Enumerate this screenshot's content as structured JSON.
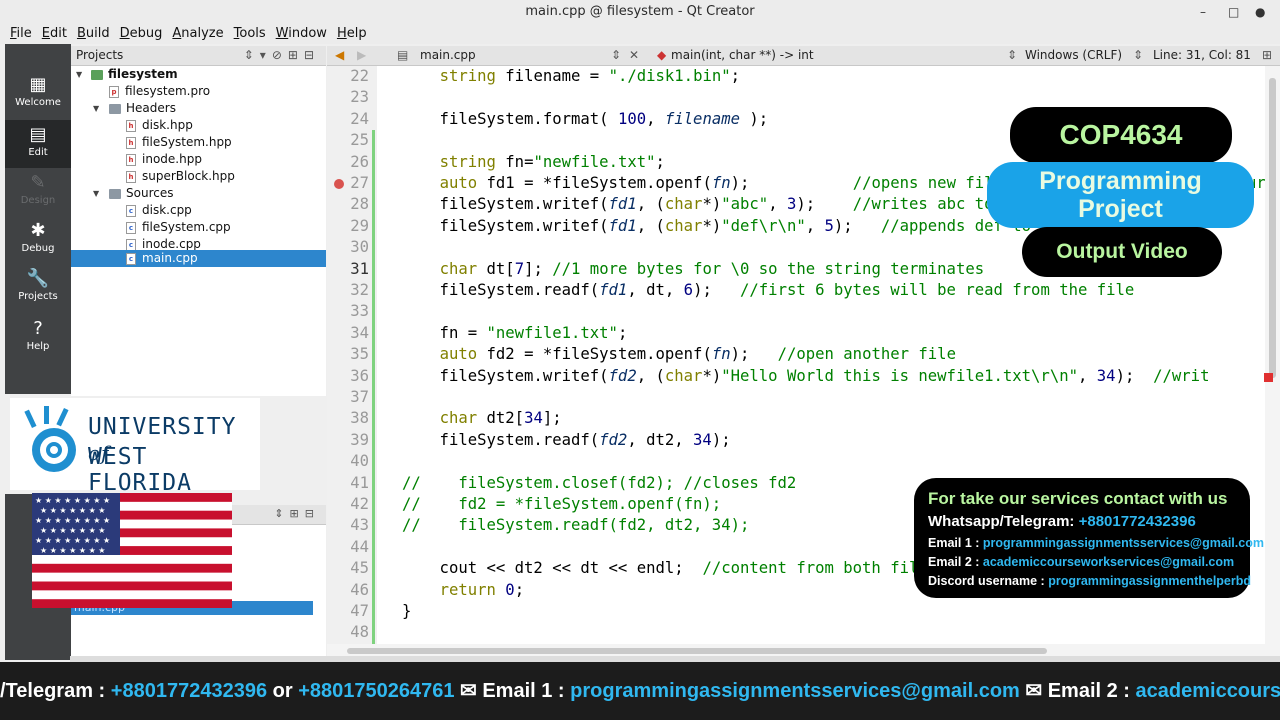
{
  "window": {
    "title": "main.cpp @ filesystem - Qt Creator",
    "minimize": "–",
    "maximize": "□",
    "close": "●"
  },
  "menu": [
    "File",
    "Edit",
    "Build",
    "Debug",
    "Analyze",
    "Tools",
    "Window",
    "Help"
  ],
  "modes": [
    {
      "label": "Welcome",
      "glyph": "▦",
      "icon": "grid-icon"
    },
    {
      "label": "Edit",
      "glyph": "▤",
      "icon": "document-icon"
    },
    {
      "label": "Design",
      "glyph": "✎",
      "icon": "pencil-icon"
    },
    {
      "label": "Debug",
      "glyph": "✱",
      "icon": "bug-icon"
    },
    {
      "label": "Projects",
      "glyph": "🔧",
      "icon": "wrench-icon"
    },
    {
      "label": "Help",
      "glyph": "?",
      "icon": "help-icon"
    }
  ],
  "projects_panel": {
    "title": "Projects",
    "project": "filesystem",
    "pro_file": "filesystem.pro",
    "headers_label": "Headers",
    "headers": [
      "disk.hpp",
      "fileSystem.hpp",
      "inode.hpp",
      "superBlock.hpp"
    ],
    "sources_label": "Sources",
    "sources": [
      "disk.cpp",
      "fileSystem.cpp",
      "inode.cpp",
      "main.cpp"
    ]
  },
  "lower_panel": {
    "selected_file": "main.cpp"
  },
  "editor_header": {
    "file": "main.cpp",
    "function": "main(int, char **) -> int",
    "line_ending": "Windows (CRLF)",
    "position": "Line: 31, Col: 81"
  },
  "code": [
    {
      "n": "22",
      "html": "    <span class=\"k\">string</span> filename = <span class=\"s\">\"./disk1.bin\"</span>;"
    },
    {
      "n": "23",
      "html": ""
    },
    {
      "n": "24",
      "html": "    fileSystem.format( <span class=\"n\">100</span>, <span class=\"p\">filename</span> );"
    },
    {
      "n": "25",
      "html": ""
    },
    {
      "n": "26",
      "html": "    <span class=\"k\">string</span> fn=<span class=\"s\">\"newfile.txt\"</span>;"
    },
    {
      "n": "27",
      "html": "    <span class=\"k\">auto</span> fd1 = *fileSystem.openf(<span class=\"p\">fn</span>);           <span class=\"c\">//opens new file named newfile.txt and returns an in</span>",
      "bp": true
    },
    {
      "n": "28",
      "html": "    fileSystem.writef(<span class=\"p\">fd1</span>, (<span class=\"k\">char</span>*)<span class=\"s\">\"abc\"</span>, <span class=\"n\">3</span>);    <span class=\"c\">//writes abc to newfile.txt</span>"
    },
    {
      "n": "29",
      "html": "    fileSystem.writef(<span class=\"p\">fd1</span>, (<span class=\"k\">char</span>*)<span class=\"s\">\"def\\r\\n\"</span>, <span class=\"n\">5</span>);   <span class=\"c\">//appends def to the file</span>"
    },
    {
      "n": "30",
      "html": ""
    },
    {
      "n": "31",
      "html": "    <span class=\"k\">char</span> dt[<span class=\"n\">7</span>]; <span class=\"c\">//1 more bytes for \\0 so the string terminates</span>",
      "cur": true
    },
    {
      "n": "32",
      "html": "    fileSystem.readf(<span class=\"p\">fd1</span>, dt, <span class=\"n\">6</span>);   <span class=\"c\">//first 6 bytes will be read from the file</span>"
    },
    {
      "n": "33",
      "html": ""
    },
    {
      "n": "34",
      "html": "    fn = <span class=\"s\">\"newfile1.txt\"</span>;"
    },
    {
      "n": "35",
      "html": "    <span class=\"k\">auto</span> fd2 = *fileSystem.openf(<span class=\"p\">fn</span>);   <span class=\"c\">//open another file</span>"
    },
    {
      "n": "36",
      "html": "    fileSystem.writef(<span class=\"p\">fd2</span>, (<span class=\"k\">char</span>*)<span class=\"s\">\"Hello World this is newfile1.txt\\r\\n\"</span>, <span class=\"n\">34</span>);  <span class=\"c\">//writ</span>"
    },
    {
      "n": "37",
      "html": ""
    },
    {
      "n": "38",
      "html": "    <span class=\"k\">char</span> dt2[<span class=\"n\">34</span>];"
    },
    {
      "n": "39",
      "html": "    fileSystem.readf(<span class=\"p\">fd2</span>, dt2, <span class=\"n\">34</span>);"
    },
    {
      "n": "40",
      "html": ""
    },
    {
      "n": "41",
      "html": "<span class=\"c\">//    fileSystem.closef(fd2); //closes fd2</span>"
    },
    {
      "n": "42",
      "html": "<span class=\"c\">//    fd2 = *fileSystem.openf(fn);</span>"
    },
    {
      "n": "43",
      "html": "<span class=\"c\">//    fileSystem.readf(fd2, dt2, 34);</span>"
    },
    {
      "n": "44",
      "html": ""
    },
    {
      "n": "45",
      "html": "    cout &lt;&lt; dt2 &lt;&lt; dt &lt;&lt; endl;  <span class=\"c\">//content from both files</span>"
    },
    {
      "n": "46",
      "html": "    <span class=\"k\">return</span> <span class=\"n\">0</span>;"
    },
    {
      "n": "47",
      "html": "}"
    },
    {
      "n": "48",
      "html": ""
    }
  ],
  "overlay": {
    "course": "COP4634",
    "project_line1": "Programming",
    "project_line2": "Project",
    "output": "Output Video",
    "university_line1": "UNIVERSITY",
    "university_of": "of",
    "university_line2": "WEST FLORIDA"
  },
  "contact": {
    "heading": "For take our services contact with us",
    "whatsapp_label": "Whatsapp/Telegram:",
    "whatsapp_value": "+8801772432396",
    "email1_label": "Email 1 :",
    "email1_value": "programmingassignmentsservices@gmail.com",
    "email2_label": "Email 2 :",
    "email2_value": "academiccourseworkservices@gmail.com",
    "discord_label": "Discord username :",
    "discord_value": "programmingassignmenthelperbd"
  },
  "ticker": {
    "t1": "/Telegram : ",
    "v1": "+8801772432396",
    "t2": " or ",
    "v2": "+8801750264761",
    "t3": " ✉ Email 1 : ",
    "v3": "programmingassignmentsservices@gmail.com",
    "t4": " ✉ Email 2 : ",
    "v4": "academiccourseworkservices@gmail.com"
  },
  "colors": {
    "pill_dark": "#000000",
    "pill_blue": "#1aa3e8",
    "pill_text": "#b9f5a0",
    "link_blue": "#30b8f0",
    "selection": "#2d86cd"
  }
}
